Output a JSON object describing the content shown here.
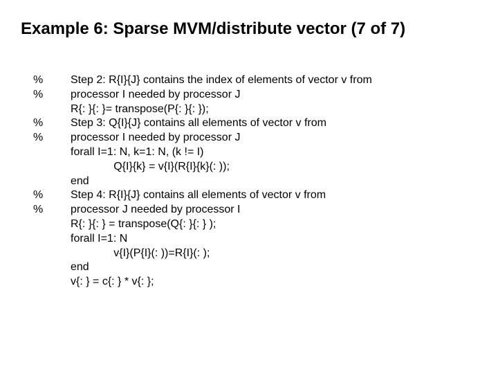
{
  "title": "Example 6: Sparse MVM/distribute vector (7 of 7)",
  "lines": [
    {
      "gutter": "%",
      "text": "Step 2: R{I}{J} contains the index of elements of vector v from"
    },
    {
      "gutter": "%",
      "text": "processor I needed by processor J"
    },
    {
      "gutter": "",
      "text": "R{: }{: }= transpose(P{: }{: });"
    },
    {
      "gutter": "%",
      "text": "Step 3: Q{I}{J} contains all elements of vector v from"
    },
    {
      "gutter": "%",
      "text": "processor I needed by processor J"
    },
    {
      "gutter": "",
      "text": "forall I=1: N, k=1: N, (k != I)"
    },
    {
      "gutter": "",
      "text": "              Q{I}{k} = v{I}(R{I}{k}(: ));"
    },
    {
      "gutter": "",
      "text": "end"
    },
    {
      "gutter": "%",
      "text": "Step 4: R{I}{J} contains all elements of vector v from"
    },
    {
      "gutter": "%",
      "text": "processor J needed by processor I"
    },
    {
      "gutter": "",
      "text": "R{: }{: } = transpose(Q{: }{: } );"
    },
    {
      "gutter": "",
      "text": "forall I=1: N"
    },
    {
      "gutter": "",
      "text": "              v{I}(P{I}(: ))=R{I}(: );"
    },
    {
      "gutter": "",
      "text": "end"
    },
    {
      "gutter": "",
      "text": "v{: } = c{: } * v{: };"
    }
  ]
}
